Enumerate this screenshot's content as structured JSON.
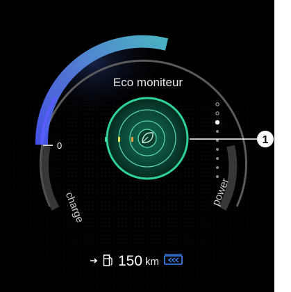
{
  "gauge": {
    "title": "Eco moniteur",
    "zero_label": "0",
    "left_label": "charge",
    "right_label": "power",
    "callout_number": "1"
  },
  "range": {
    "value": "150",
    "unit": "km"
  },
  "image_ref": "74203",
  "colors": {
    "eco_green": "#1fc28e",
    "arc_blue": "#6688ff",
    "arc_cyan": "#4dd0e1",
    "marker_yellow": "#e8e05a",
    "marker_orange": "#e89a3a",
    "battery_blue": "#3d8bff"
  },
  "icons": [
    "arrow-right-icon",
    "fuel-pump-icon",
    "battery-charge-icon",
    "leaf-icon"
  ]
}
